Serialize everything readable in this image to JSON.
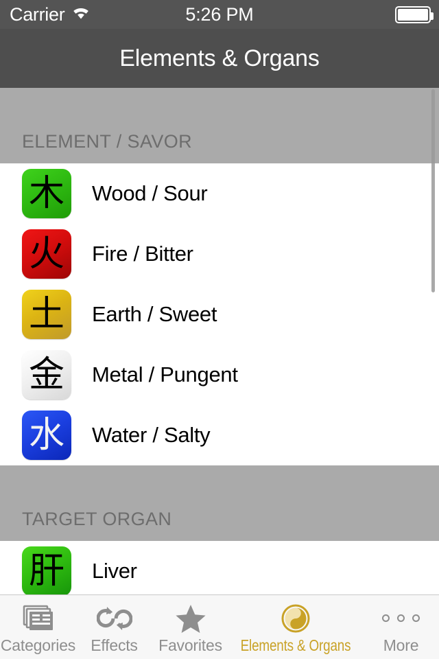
{
  "status_bar": {
    "carrier": "Carrier",
    "wifi_icon": "wifi-icon",
    "time": "5:26 PM",
    "battery_icon": "battery-full-icon"
  },
  "nav_bar": {
    "title": "Elements & Organs"
  },
  "colors": {
    "nav_background": "#4e4e4e",
    "status_background": "#545454",
    "section_header_background": "#aaaaaa",
    "section_header_text": "#6d6d6d",
    "row_background": "#ffffff",
    "row_text": "#000000",
    "tabbar_background": "#f7f7f7",
    "tab_inactive": "#8e8e8e",
    "tab_active": "#c9a227"
  },
  "sections": [
    {
      "header": "ELEMENT / SAVOR",
      "rows": [
        {
          "glyph": "木",
          "label": "Wood / Sour",
          "icon_class": "ic-wood",
          "icon_name": "element-icon-wood"
        },
        {
          "glyph": "火",
          "label": "Fire / Bitter",
          "icon_class": "ic-fire",
          "icon_name": "element-icon-fire"
        },
        {
          "glyph": "土",
          "label": "Earth / Sweet",
          "icon_class": "ic-earth",
          "icon_name": "element-icon-earth"
        },
        {
          "glyph": "金",
          "label": "Metal / Pungent",
          "icon_class": "ic-metal",
          "icon_name": "element-icon-metal"
        },
        {
          "glyph": "水",
          "label": "Water / Salty",
          "icon_class": "ic-water",
          "icon_name": "element-icon-water"
        }
      ]
    },
    {
      "header": "TARGET ORGAN",
      "rows": [
        {
          "glyph": "肝",
          "label": "Liver",
          "icon_class": "ic-liver",
          "icon_name": "organ-icon-liver"
        }
      ]
    }
  ],
  "tabs": [
    {
      "label": "Categories",
      "icon": "stacked-cards-icon",
      "active": false
    },
    {
      "label": "Effects",
      "icon": "refresh-cycle-icon",
      "active": false
    },
    {
      "label": "Favorites",
      "icon": "star-icon",
      "active": false
    },
    {
      "label": "Elements & Organs",
      "icon": "yin-yang-icon",
      "active": true
    },
    {
      "label": "More",
      "icon": "ellipsis-icon",
      "active": false
    }
  ]
}
